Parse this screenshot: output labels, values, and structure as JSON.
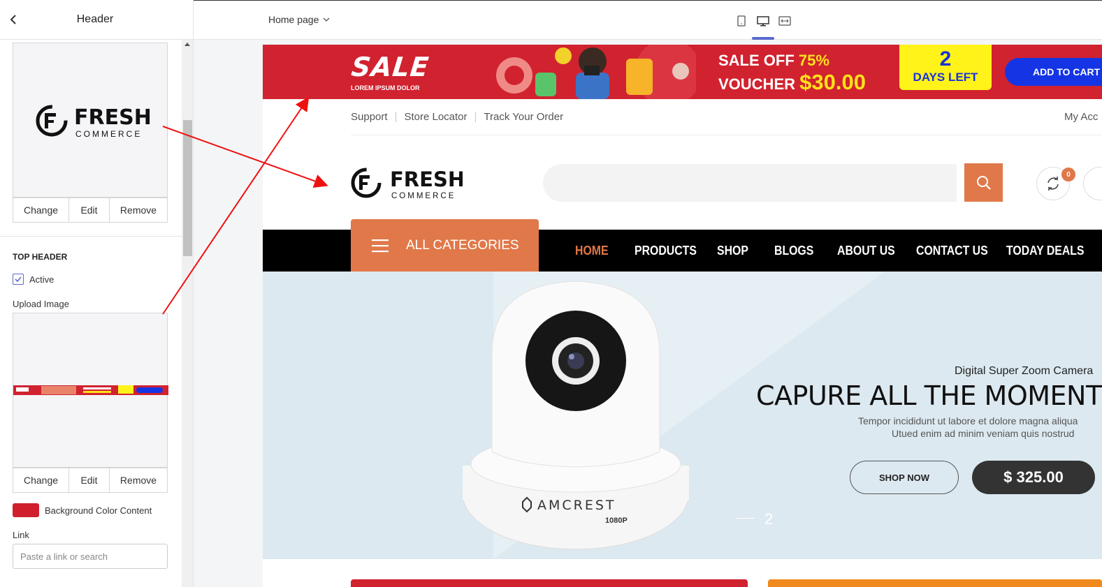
{
  "sidebar": {
    "title": "Header",
    "logo_image": {
      "change_label": "Change",
      "edit_label": "Edit",
      "remove_label": "Remove"
    },
    "top_header": {
      "section_title": "TOP HEADER",
      "active_label": "Active",
      "active_checked": true,
      "upload_label": "Upload Image",
      "change_label": "Change",
      "edit_label": "Edit",
      "remove_label": "Remove",
      "bg_color_label": "Background Color Content",
      "bg_color": "#d0202e",
      "link_label": "Link",
      "link_placeholder": "Paste a link or search"
    }
  },
  "topbar": {
    "page_selector": "Home page",
    "devices": [
      "mobile-icon",
      "desktop-icon",
      "fullwidth-icon"
    ],
    "active_device": "desktop-icon"
  },
  "preview": {
    "banner": {
      "sale_text": "SALE",
      "sale_sub": "LOREM IPSUM DOLOR",
      "sale_off_label": "SALE OFF",
      "sale_off_value": "75%",
      "voucher_label": "VOUCHER",
      "voucher_value": "$30.00",
      "days_number": "2",
      "days_text": "DAYS LEFT",
      "cta": "ADD TO CART"
    },
    "top_links": [
      "Support",
      "Store Locator",
      "Track Your Order"
    ],
    "my_account": "My Acc",
    "logo_main": "FRESH",
    "logo_sub": "COMMERCE",
    "compare_count": "0",
    "all_categories": "ALL CATEGORIES",
    "nav": [
      "HOME",
      "PRODUCTS",
      "SHOP",
      "BLOGS",
      "ABOUT US",
      "CONTACT US",
      "TODAY DEALS"
    ],
    "nav_active": "HOME",
    "hero": {
      "subtitle": "Digital Super Zoom Camera",
      "title": "CAPURE ALL THE MOMENTS",
      "desc_line1": "Tempor incididunt ut labore et dolore magna aliqua",
      "desc_line2": "Utued enim ad minim veniam quis nostrud",
      "shop_now": "SHOP NOW",
      "price": "$ 325.00",
      "slide_number": "2",
      "camera_brand": "AMCREST",
      "camera_model": "1080P"
    }
  },
  "colors": {
    "accent": "#e07849",
    "banner_red": "#d1222f",
    "editor_blue": "#5a6acf"
  }
}
